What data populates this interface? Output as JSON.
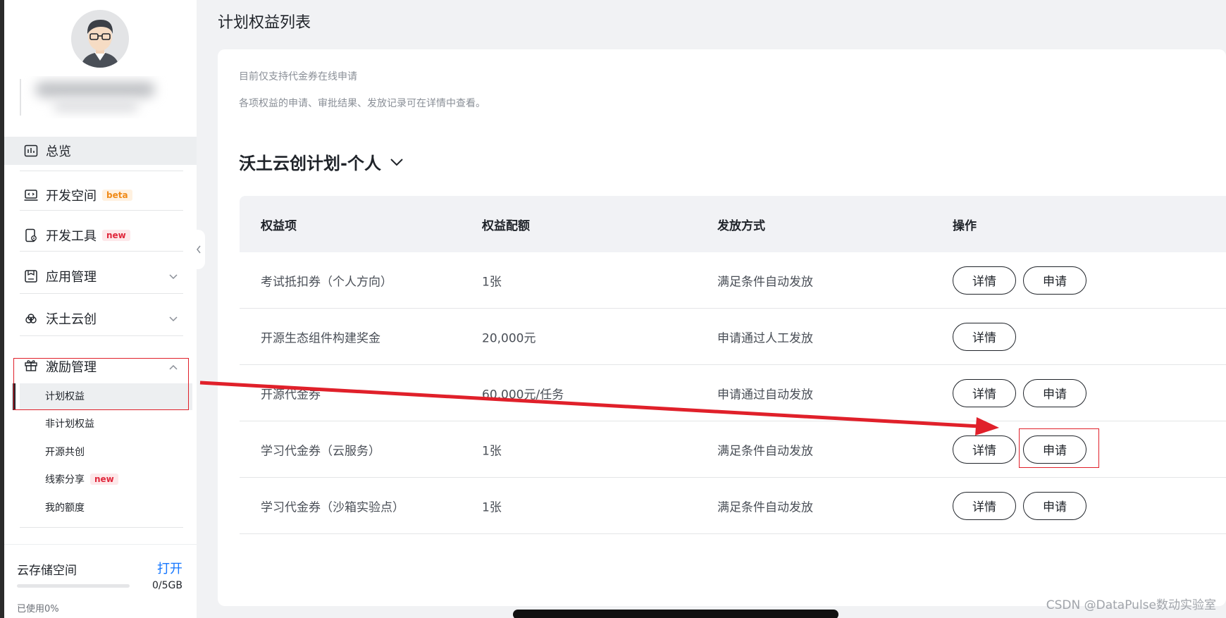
{
  "sidebar": {
    "overview": "总览",
    "items": [
      {
        "label": "开发空间",
        "badge": "beta"
      },
      {
        "label": "开发工具",
        "badge": "new"
      },
      {
        "label": "应用管理"
      },
      {
        "label": "沃土云创"
      },
      {
        "label": "激励管理"
      }
    ],
    "sub_items": [
      {
        "label": "计划权益"
      },
      {
        "label": "非计划权益"
      },
      {
        "label": "开源共创"
      },
      {
        "label": "线索分享",
        "badge": "new"
      },
      {
        "label": "我的额度"
      }
    ],
    "storage": {
      "title": "云存储空间",
      "open_label": "打开",
      "size": "0/5GB",
      "used_label": "已使用0%",
      "used_percent": 0
    }
  },
  "page": {
    "title": "计划权益列表",
    "hint1": "目前仅支持代金券在线申请",
    "hint2": "各项权益的申请、审批结果、发放记录可在详情中查看。",
    "plan_name": "沃土云创计划-个人"
  },
  "table": {
    "headers": [
      "权益项",
      "权益配额",
      "发放方式",
      "操作"
    ],
    "rows": [
      {
        "item": "考试抵扣券（个人方向）",
        "quota": "1张",
        "method": "满足条件自动发放",
        "detail": "详情",
        "apply": "申请"
      },
      {
        "item": "开源生态组件构建奖金",
        "quota": "20,000元",
        "method": "申请通过人工发放",
        "detail": "详情",
        "apply": ""
      },
      {
        "item": "开源代金券",
        "quota": "60,000元/任务",
        "method": "申请通过自动发放",
        "detail": "详情",
        "apply": "申请"
      },
      {
        "item": "学习代金券（云服务）",
        "quota": "1张",
        "method": "满足条件自动发放",
        "detail": "详情",
        "apply": "申请"
      },
      {
        "item": "学习代金券（沙箱实验点）",
        "quota": "1张",
        "method": "满足条件自动发放",
        "detail": "详情",
        "apply": "申请"
      }
    ]
  },
  "watermark": "CSDN @DataPulse数动实验室",
  "colors": {
    "accent": "#1677ff",
    "annotation": "#e0202a"
  }
}
